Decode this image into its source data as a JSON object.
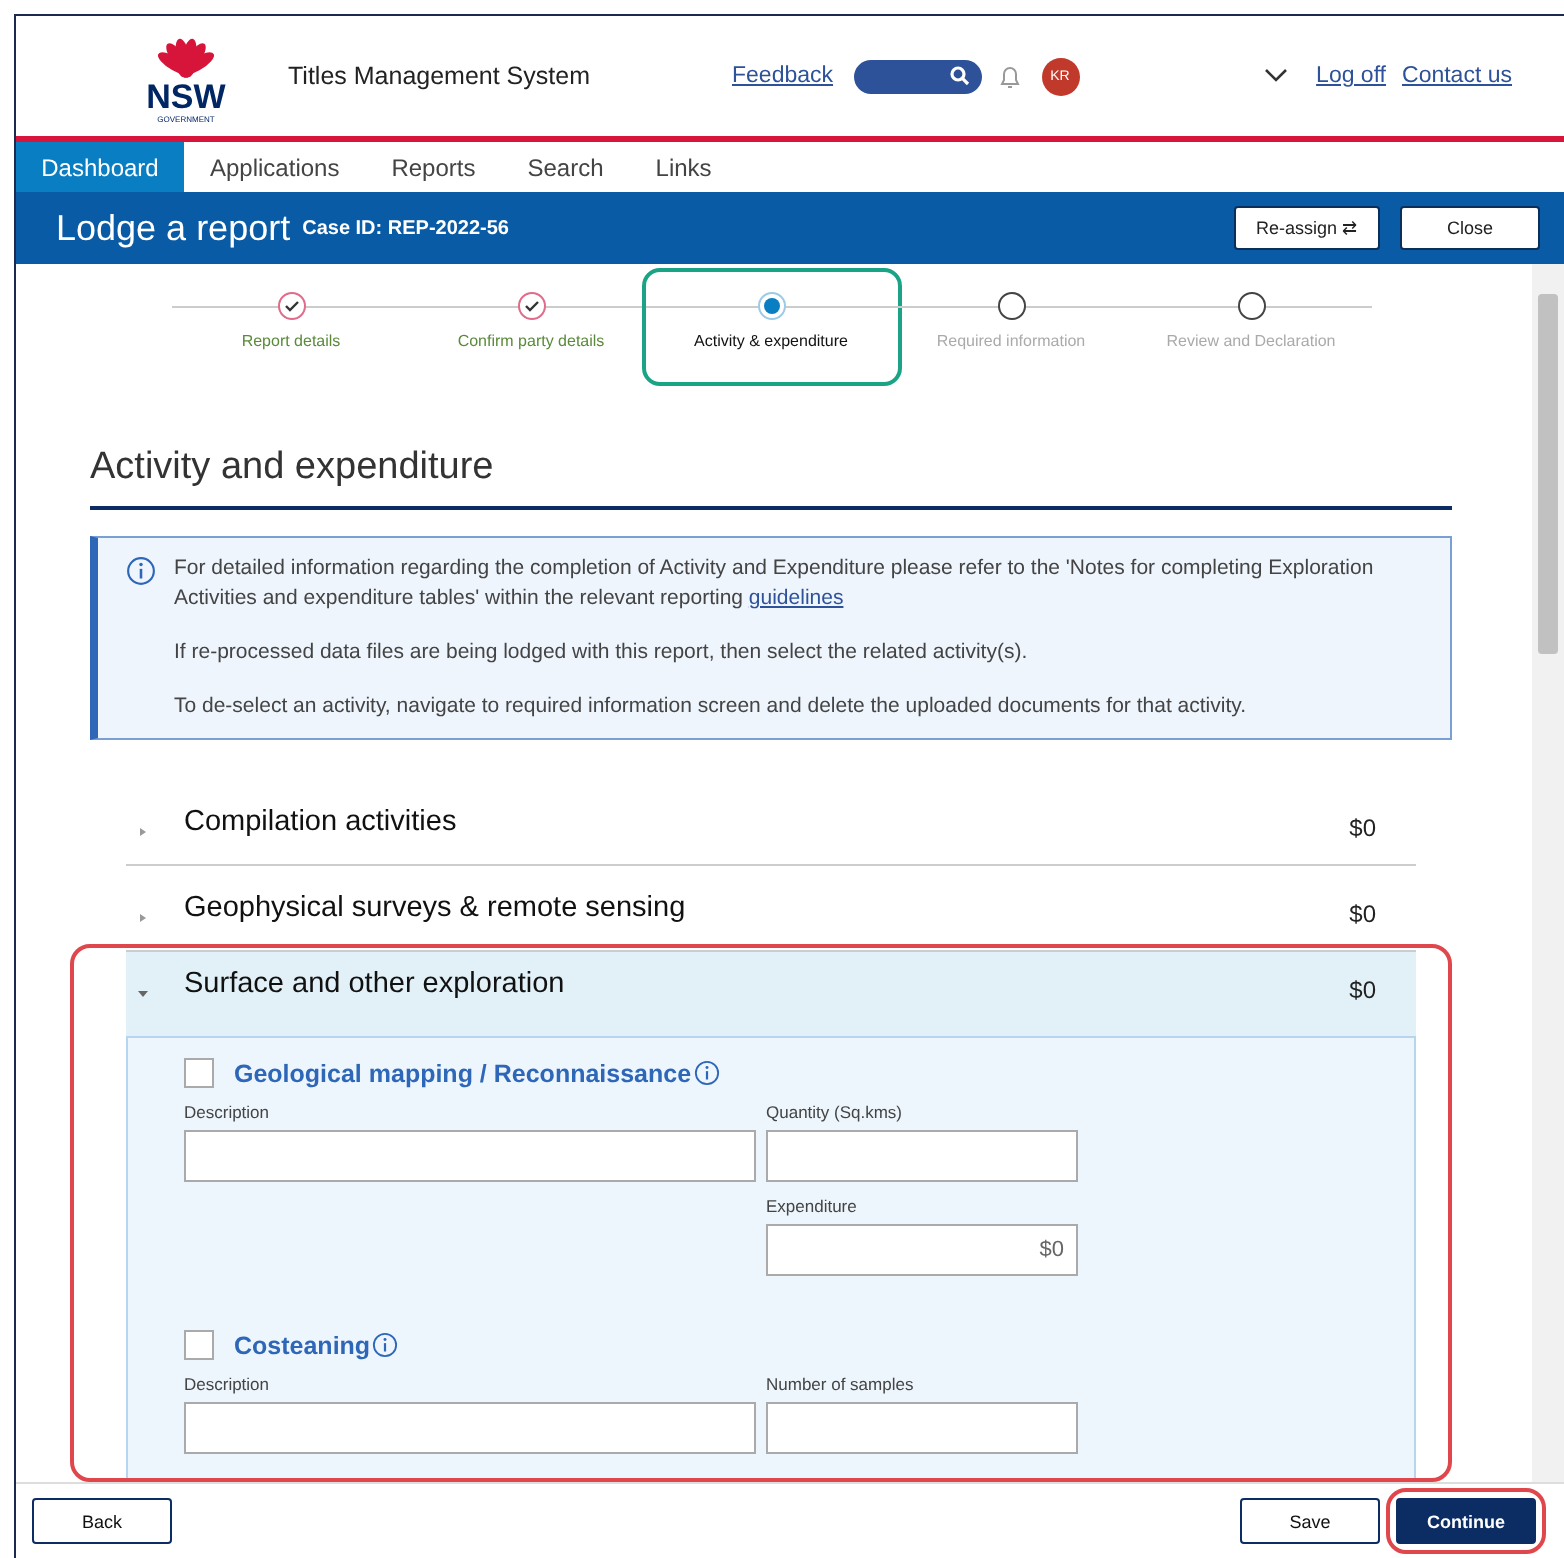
{
  "header": {
    "app_title": "Titles Management System",
    "feedback": "Feedback",
    "avatar": "KR",
    "logo_text": "NSW",
    "logo_sub": "GOVERNMENT",
    "links": [
      "Log off",
      "Contact us"
    ]
  },
  "nav": [
    {
      "label": "Dashboard",
      "selected": true
    },
    {
      "label": "Applications",
      "selected": false
    },
    {
      "label": "Reports",
      "selected": false
    },
    {
      "label": "Search",
      "selected": false
    },
    {
      "label": "Links",
      "selected": false
    }
  ],
  "title_bar": {
    "title": "Lodge a report",
    "case_id": "Case ID: REP-2022-56",
    "buttons": [
      {
        "label": "Re-assign ⇄"
      },
      {
        "label": "Close"
      }
    ]
  },
  "steps": [
    {
      "label": "Report details",
      "kind": "done",
      "highlighted": false
    },
    {
      "label": "Confirm party details",
      "kind": "done",
      "highlighted": false
    },
    {
      "label": "Activity & expenditure",
      "kind": "current",
      "highlighted": true
    },
    {
      "label": "Required information",
      "kind": "todo",
      "highlighted": false
    },
    {
      "label": "Review and Declaration",
      "kind": "todo",
      "highlighted": false
    }
  ],
  "heading": "Activity and expenditure",
  "info": {
    "paragraphs": [
      "For detailed information regarding the completion of Activity and Expenditure please refer to the 'Notes for completing Exploration Activities and expenditure tables' within the relevant reporting",
      "If re-processed data files are being lodged with this report, then select the related activity(s).",
      "To de-select an activity, navigate to required information screen and delete the uploaded documents for that activity."
    ],
    "link": "guidelines"
  },
  "sections": [
    {
      "title": "Compilation activities",
      "amount": "$0",
      "expanded": false,
      "highlighted": false
    },
    {
      "title": "Geophysical surveys & remote sensing",
      "amount": "$0",
      "expanded": false,
      "highlighted": false
    },
    {
      "title": "Surface and other exploration",
      "amount": "$0",
      "expanded": true,
      "highlighted": true,
      "activities": [
        {
          "name": "Geological mapping / Reconnaissance",
          "checked": false,
          "description_label": "Description",
          "fields": [
            {
              "label": "Quantity (Sq.kms)"
            },
            {
              "label": "Expenditure",
              "value": "$0"
            }
          ]
        },
        {
          "name": "Costeaning",
          "checked": false,
          "description_label": "Description",
          "fields": [
            {
              "label": "Number of samples"
            }
          ]
        }
      ]
    }
  ],
  "footer": {
    "back": "Back",
    "save": "Save",
    "continue": {
      "label": "Continue",
      "highlighted": true
    }
  }
}
